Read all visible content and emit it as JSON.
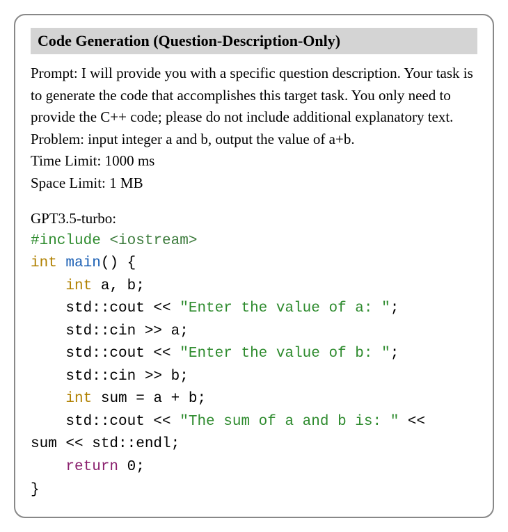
{
  "title": "Code Generation (Question-Description-Only)",
  "prompt": "Prompt: I will provide you with a specific question description. Your task is to generate the code that accomplishes this target task. You only need to provide the C++ code; please do not include additional explanatory text.",
  "problem": "Problem: input integer a and b, output the value of a+b.",
  "time_limit": "Time Limit: 1000 ms",
  "space_limit": "Space Limit: 1 MB",
  "model_label": "GPT3.5-turbo:",
  "code": {
    "l1_include": "#include",
    "l1_header": "<iostream>",
    "l2_int": "int",
    "l2_main": "main",
    "l2_paren": "() {",
    "l3_int": "int",
    "l3_rest": " a, b;",
    "l4": "    std::cout << ",
    "l4_str": "\"Enter the value of a: \"",
    "l4_end": ";",
    "l5": "    std::cin >> a;",
    "l6": "    std::cout << ",
    "l6_str": "\"Enter the value of b: \"",
    "l6_end": ";",
    "l7": "    std::cin >> b;",
    "l8_int": "int",
    "l8_rest": " sum = a + b;",
    "l9": "    std::cout << ",
    "l9_str": "\"The sum of a and b is: \"",
    "l9_end": " <<",
    "l10": "sum << std::endl;",
    "l11_return": "return",
    "l11_val": " 0;",
    "l12": "}"
  }
}
